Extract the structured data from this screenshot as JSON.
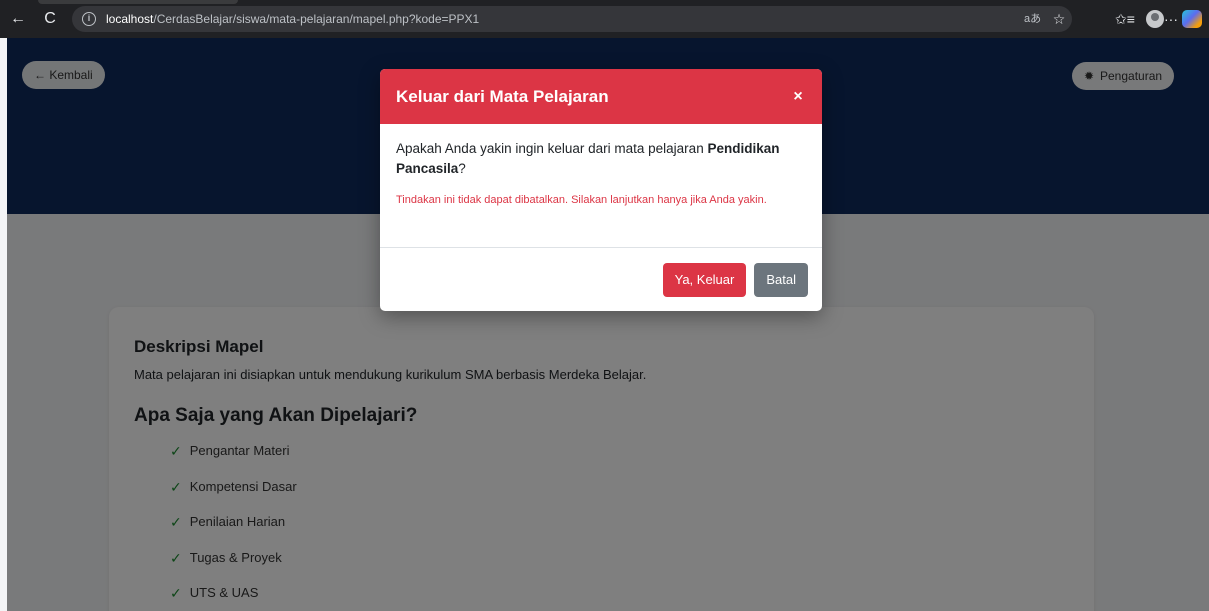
{
  "browser": {
    "back_glyph": "←",
    "refresh_glyph": "C",
    "url_host": "localhost",
    "url_path": "/CerdasBelajar/siswa/mata-pelajaran/mapel.php?kode=PPX1",
    "read_aloud_glyph": "aあ",
    "favorite_glyph": "☆",
    "collections_glyph": "✩≡",
    "more_glyph": "···"
  },
  "page": {
    "back_label": "← Kembali",
    "settings_label": "Pengaturan"
  },
  "card": {
    "desc_title": "Deskripsi Mapel",
    "desc_text": "Mata pelajaran ini disiapkan untuk mendukung kurikulum SMA berbasis Merdeka Belajar.",
    "learn_title": "Apa Saja yang Akan Dipelajari?",
    "check_glyph": "✓",
    "items": [
      "Pengantar Materi",
      "Kompetensi Dasar",
      "Penilaian Harian",
      "Tugas & Proyek",
      "UTS & UAS"
    ]
  },
  "modal": {
    "title": "Keluar dari Mata Pelajaran",
    "close_glyph": "×",
    "question_prefix": "Apakah Anda yakin ingin keluar dari mata pelajaran ",
    "subject_name": "Pendidikan Pancasila",
    "question_suffix": "?",
    "warning": "Tindakan ini tidak dapat dibatalkan. Silakan lanjutkan hanya jika Anda yakin.",
    "confirm_label": "Ya, Keluar",
    "cancel_label": "Batal"
  },
  "colors": {
    "hero": "#0f2a5c",
    "danger": "#dc3545",
    "secondary": "#6c757d",
    "check": "#1b8a2f"
  }
}
